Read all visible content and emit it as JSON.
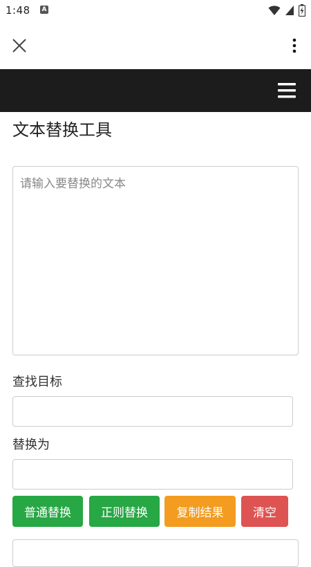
{
  "status_bar": {
    "time": "1:48",
    "notification_letter": "A",
    "icons": [
      "wifi-icon",
      "signal-icon",
      "battery-charging-icon"
    ]
  },
  "app_bar": {
    "close_icon": "close-icon",
    "more_icon": "more-vert-icon"
  },
  "navbar": {
    "menu_icon": "hamburger-menu-icon",
    "background": "#1c1c1c"
  },
  "main": {
    "title": "文本替换工具",
    "source_textarea": {
      "value": "",
      "placeholder": "请输入要替换的文本"
    },
    "find_label": "查找目标",
    "find_input": {
      "value": "",
      "placeholder": ""
    },
    "replace_label": "替换为",
    "replace_input": {
      "value": "",
      "placeholder": ""
    },
    "buttons": {
      "normal_replace": "普通替换",
      "regex_replace": "正则替换",
      "copy_result": "复制结果",
      "clear": "清空"
    }
  },
  "colors": {
    "green": "#28a745",
    "orange": "#f39c1f",
    "red": "#dd5452"
  }
}
